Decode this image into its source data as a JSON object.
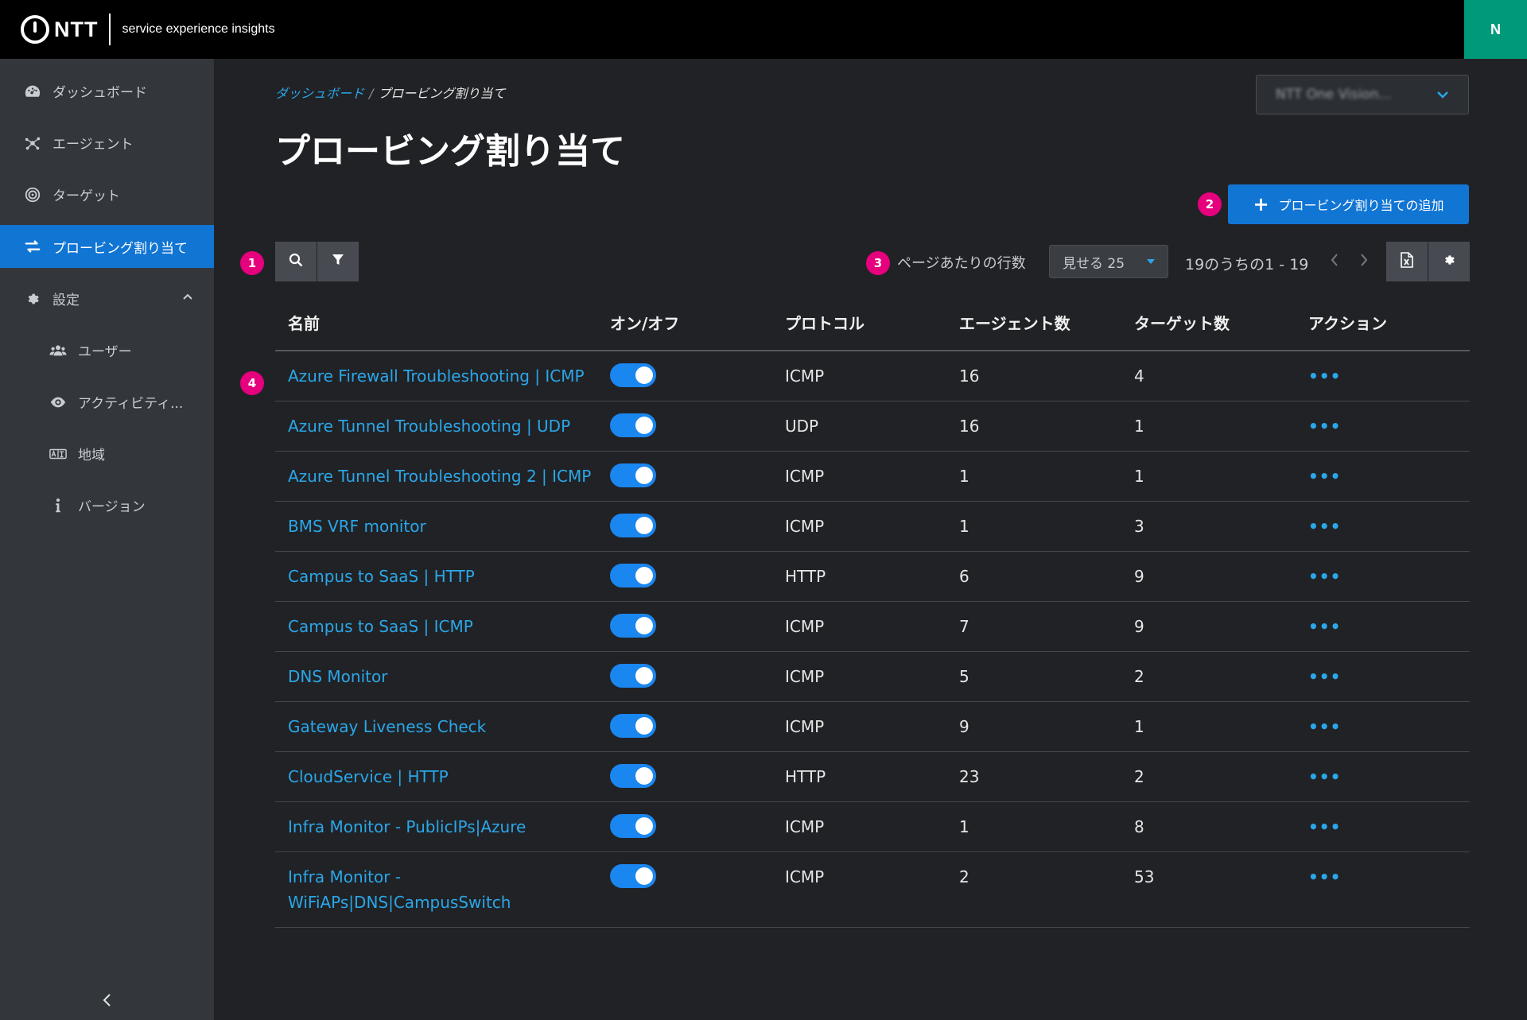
{
  "header": {
    "logo_text": "NTT",
    "app_name": "service experience insights",
    "avatar_initial": "N"
  },
  "sidebar": {
    "items": [
      {
        "label": "ダッシュボード",
        "icon": "dashboard-icon"
      },
      {
        "label": "エージェント",
        "icon": "agent-icon"
      },
      {
        "label": "ターゲット",
        "icon": "target-icon"
      },
      {
        "label": "プロービング割り当て",
        "icon": "swap-icon",
        "active": true
      },
      {
        "label": "設定",
        "icon": "gear-icon"
      }
    ],
    "sub_items": [
      {
        "label": "ユーザー",
        "icon": "users-icon"
      },
      {
        "label": "アクティビティ...",
        "icon": "eye-icon"
      },
      {
        "label": "地域",
        "icon": "language-icon"
      },
      {
        "label": "バージョン",
        "icon": "info-icon"
      }
    ]
  },
  "breadcrumb": {
    "link": "ダッシュボード",
    "separator": "/",
    "current": "プロービング割り当て"
  },
  "page": {
    "title": "プロービング割り当て",
    "tenant_select": "NTT One Vision..."
  },
  "badges": [
    "1",
    "2",
    "3",
    "4"
  ],
  "toolbar": {
    "add_label": "プロービング割り当ての追加",
    "rows_label": "ページあたりの行数",
    "rows_select": "見せる 25",
    "pager_text": "19のうちの1 - 19"
  },
  "table": {
    "headers": [
      "名前",
      "オン/オフ",
      "プロトコル",
      "エージェント数",
      "ターゲット数",
      "アクション"
    ],
    "rows": [
      {
        "name": "Azure Firewall Troubleshooting | ICMP",
        "on": true,
        "protocol": "ICMP",
        "agents": "16",
        "targets": "4"
      },
      {
        "name": "Azure Tunnel Troubleshooting | UDP",
        "on": true,
        "protocol": "UDP",
        "agents": "16",
        "targets": "1"
      },
      {
        "name": "Azure Tunnel Troubleshooting 2 | ICMP",
        "on": true,
        "protocol": "ICMP",
        "agents": "1",
        "targets": "1"
      },
      {
        "name": "BMS VRF monitor",
        "on": true,
        "protocol": "ICMP",
        "agents": "1",
        "targets": "3"
      },
      {
        "name": "Campus to SaaS | HTTP",
        "on": true,
        "protocol": "HTTP",
        "agents": "6",
        "targets": "9"
      },
      {
        "name": "Campus to SaaS | ICMP",
        "on": true,
        "protocol": "ICMP",
        "agents": "7",
        "targets": "9"
      },
      {
        "name": "DNS Monitor",
        "on": true,
        "protocol": "ICMP",
        "agents": "5",
        "targets": "2"
      },
      {
        "name": "Gateway Liveness Check",
        "on": true,
        "protocol": "ICMP",
        "agents": "9",
        "targets": "1"
      },
      {
        "name": "CloudService | HTTP",
        "on": true,
        "protocol": "HTTP",
        "agents": "23",
        "targets": "2"
      },
      {
        "name": "Infra Monitor - PublicIPs|Azure",
        "on": true,
        "protocol": "ICMP",
        "agents": "1",
        "targets": "8"
      },
      {
        "name": "Infra Monitor - WiFiAPs|DNS|CampusSwitch",
        "on": true,
        "protocol": "ICMP",
        "agents": "2",
        "targets": "53"
      }
    ],
    "action_glyph": "•••"
  },
  "colors": {
    "accent": "#1175d4",
    "link": "#2aa7e8",
    "badge": "#e6007e",
    "avatar_bg": "#009a7b",
    "toggle_on": "#1a86f0"
  }
}
